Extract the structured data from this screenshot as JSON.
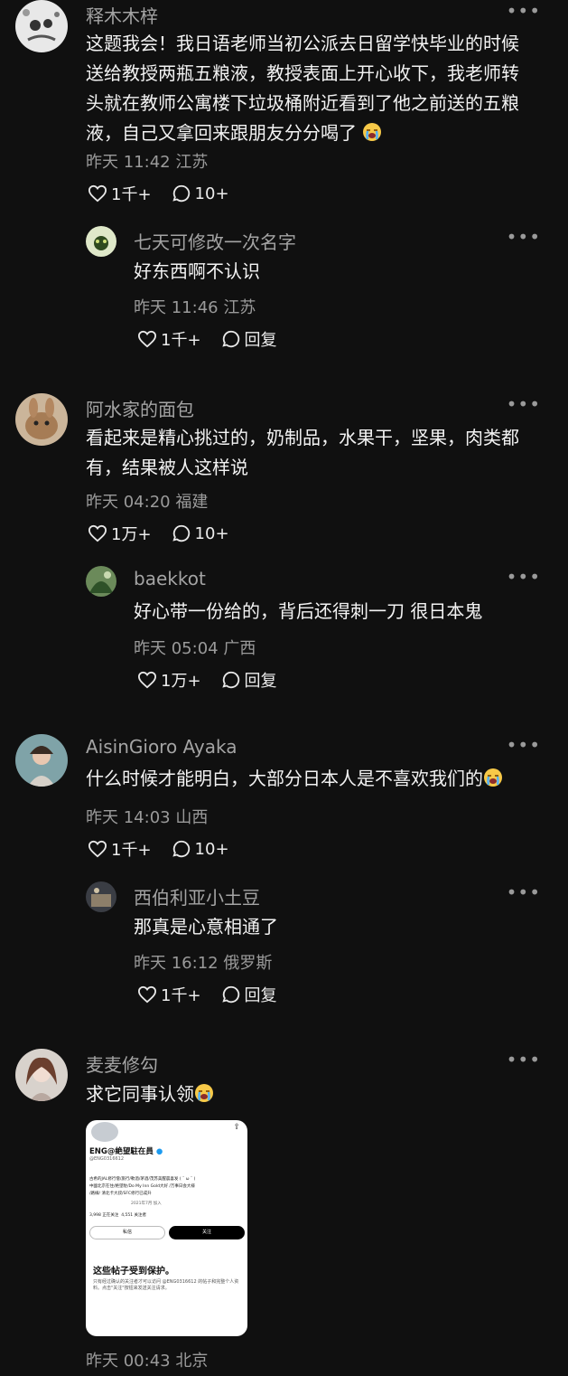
{
  "comments": [
    {
      "name": "释木木梓",
      "lines": [
        "这题我会！我日语老师当初公派去日留学快毕业的时候",
        "送给教授两瓶五粮液，教授表面上开心收下，我老师转",
        "头就在教师公寓楼下垃圾桶附近看到了他之前送的五粮",
        "液，自己又拿回来跟朋友分分喝了"
      ],
      "emoji": "crying-face",
      "time": "昨天 11:42",
      "location": "江苏",
      "likes": "1千+",
      "replies": "10+",
      "reply": {
        "name": "七天可修改一次名字",
        "text": "好东西啊不认识",
        "time": "昨天 11:46",
        "location": "江苏",
        "likes": "1千+",
        "reply_label": "回复"
      }
    },
    {
      "name": "阿水家的面包",
      "lines": [
        "看起来是精心挑过的，奶制品，水果干，坚果，肉类都",
        "有，结果被人这样说"
      ],
      "time": "昨天 04:20",
      "location": "福建",
      "likes": "1万+",
      "replies": "10+",
      "reply": {
        "name": "baekkot",
        "text": "好心带一份给的，背后还得刺一刀 很日本鬼",
        "time": "昨天 05:04",
        "location": "广西",
        "likes": "1万+",
        "reply_label": "回复"
      }
    },
    {
      "name": "AisinGioro Ayaka",
      "lines": [
        "什么时候才能明白，大部分日本人是不喜欢我们的"
      ],
      "emoji": "crying-face",
      "time": "昨天 14:03",
      "location": "山西",
      "likes": "1千+",
      "replies": "10+",
      "reply": {
        "name": "西伯利亚小土豆",
        "text": "那真是心意相通了",
        "time": "昨天 16:12",
        "location": "俄罗斯",
        "likes": "1千+",
        "reply_label": "回复"
      }
    },
    {
      "name": "麦麦修勾",
      "lines": [
        "求它同事认领"
      ],
      "emoji": "crying-face",
      "time": "昨天 00:43",
      "location": "北京"
    }
  ],
  "screenshot": {
    "display_name": "ENG@絶望駐在員",
    "handle": "@ENG0316612",
    "bio_lines": [
      "古希的JAL修行僧/旅行/軟酒/茅酒/茂苏美醒晨喜发 ( ˆ ω ˆ )",
      "中國北京在住/絶望駐/Do My Inn Gold大好 /万事日会大様",
      "/路線/ 清北卡大叔/SFC修行已成升"
    ],
    "joined": "2021年7月 加入",
    "following": "3,998 正在关注",
    "followers": "4,551 关注者",
    "message_button": "私信",
    "follow_button": "关注",
    "protected_title": "这些帖子受到保护。",
    "protected_desc": "只有经过确认的关注者才可以访问 @ENG0316612 的帖子和完整个人资料。点击\"关注\"按钮来发送关注请求。"
  },
  "colors": {
    "background": "#101010",
    "text": "#f2f2f2",
    "muted": "#9a9a9a"
  }
}
